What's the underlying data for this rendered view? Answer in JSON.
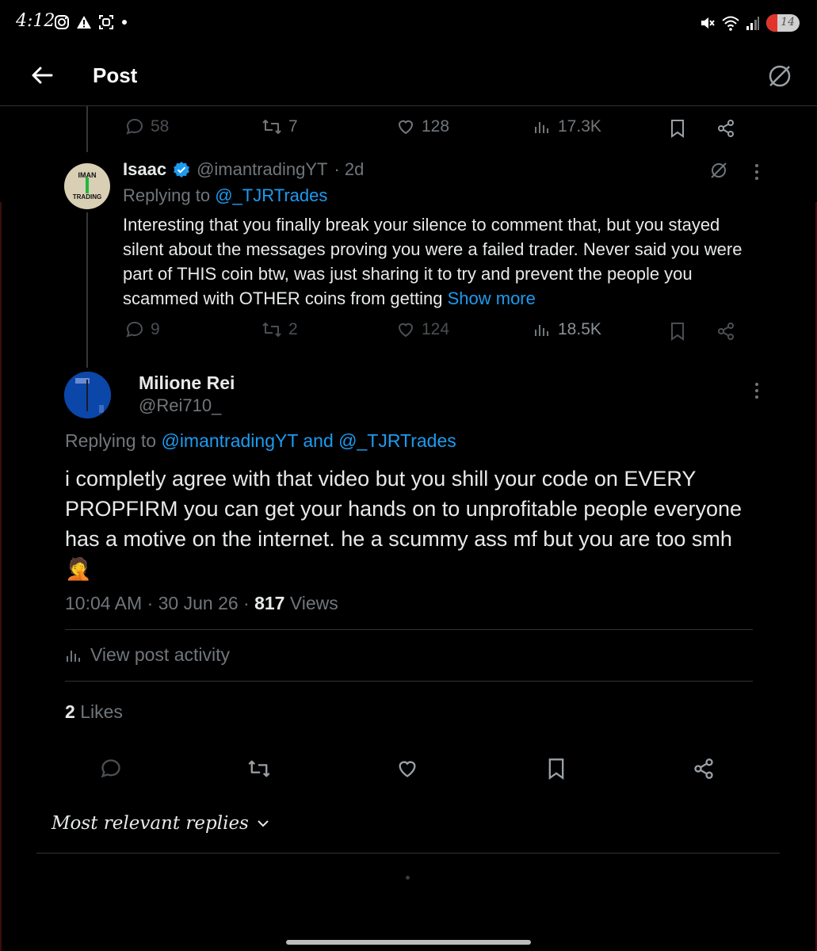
{
  "status_bar": {
    "time": "4:12",
    "battery_level": "14"
  },
  "header": {
    "title": "Post"
  },
  "prev_tweet_actions": {
    "replies": "58",
    "retweets": "7",
    "likes": "128",
    "views": "17.3K"
  },
  "reply_tweet": {
    "name": "Isaac",
    "handle": "@imantradingYT",
    "time": "· 2d",
    "avatar_text_top": "IMAN",
    "avatar_text_bottom": "TRADING",
    "replying_prefix": "Replying to",
    "replying_to": "@_TJRTrades",
    "text": "Interesting that you finally break your silence to comment that, but you stayed silent about the messages proving you were a failed trader. Never said you were part of THIS coin btw, was just sharing it to try and prevent the people you scammed with OTHER coins from getting",
    "show_more": "Show more",
    "actions": {
      "replies": "9",
      "retweets": "2",
      "likes": "124",
      "views": "18.5K"
    }
  },
  "main_tweet": {
    "name": "Milione Rei",
    "handle": "@Rei710_",
    "replying_prefix": "Replying to",
    "replying_to_1": "@imantradingYT",
    "replying_and": "and",
    "replying_to_2": "@_TJRTrades",
    "text": "i completly agree with that video but you shill your code on EVERY PROPFIRM you can get your hands on to unprofitable people everyone has a motive on the internet. he a scummy ass mf but you are too smh🤦",
    "timestamp": "10:04 AM · 30 Jun 26 ·",
    "views_count": "817",
    "views_label": "Views",
    "view_activity": "View post activity",
    "likes_count": "2",
    "likes_label": "Likes"
  },
  "replies_sort": {
    "label": "Most relevant replies"
  },
  "colors": {
    "accent": "#1d9bf0",
    "background": "#000000",
    "muted": "#71767b",
    "divider": "#2f3336"
  }
}
